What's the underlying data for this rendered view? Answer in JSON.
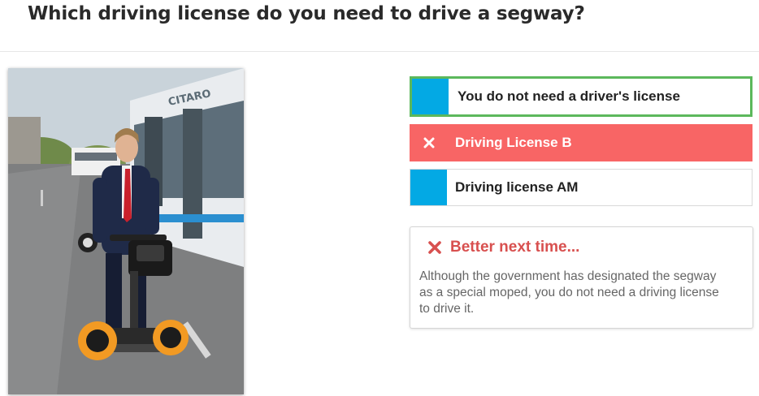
{
  "question": {
    "title": "Which driving license do you need to drive a segway?"
  },
  "photo": {
    "alt_semantic": "segway-photo"
  },
  "answers": [
    {
      "label": "You do not need a driver's license",
      "state": "correct",
      "marker_color": "#03a9e4"
    },
    {
      "label": "Driving License B",
      "state": "wrong-selected",
      "marker_icon": "cross-icon",
      "color": "#f86565"
    },
    {
      "label": "Driving license AM",
      "state": "neutral",
      "marker_color": "#03a9e4"
    }
  ],
  "feedback": {
    "title": "Better next time...",
    "icon": "cross-icon",
    "text": "Although the government has designated the segway as a special moped, you do not need a driving license to drive it.",
    "color": "#d8504f"
  },
  "colors": {
    "correct_border": "#5cb85c",
    "marker_blue": "#03a9e4",
    "wrong_red": "#f86565"
  }
}
